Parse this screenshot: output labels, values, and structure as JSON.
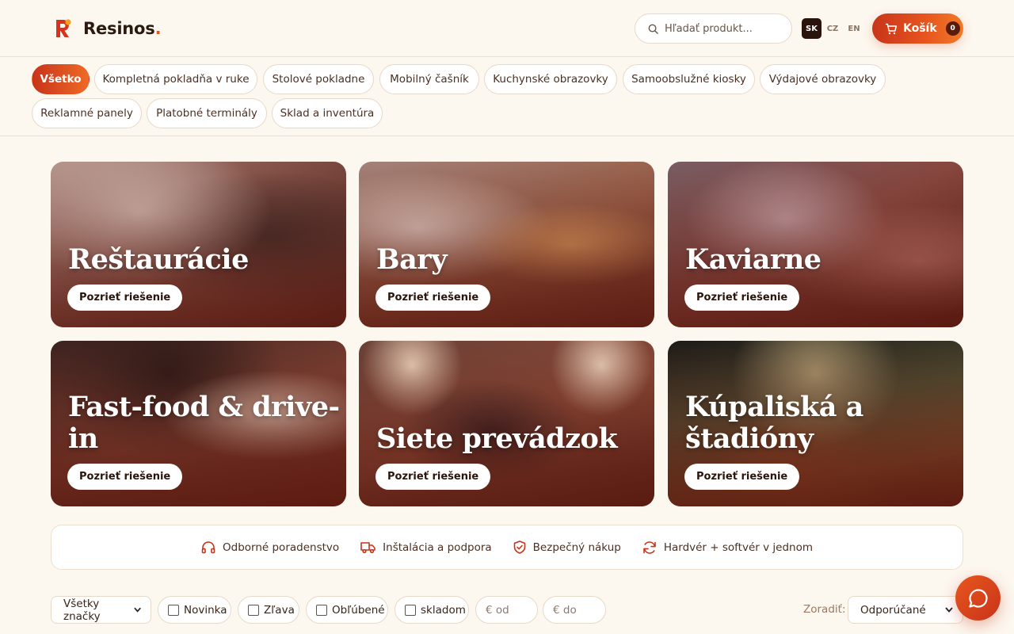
{
  "header": {
    "brand": "Resinos",
    "brand_dot": ".",
    "search_placeholder": "Hľadať produkt...",
    "languages": [
      "SK",
      "CZ",
      "EN"
    ],
    "active_language": "SK",
    "cart_label": "Košík",
    "cart_count": "0"
  },
  "categories": [
    "Všetko",
    "Kompletná pokladňa v ruke",
    "Stolové pokladne",
    "Mobilný čašník",
    "Kuchynské obrazovky",
    "Samoobslužné kiosky",
    "Výdajové obrazovky",
    "Reklamné panely",
    "Platobné terminály",
    "Sklad a inventúra"
  ],
  "active_category": "Všetko",
  "solutions": {
    "button_label": "Pozrieť riešenie",
    "items": [
      {
        "title": "Reštaurácie"
      },
      {
        "title": "Bary"
      },
      {
        "title": "Kaviarne"
      },
      {
        "title": "Fast-food & drive-in"
      },
      {
        "title": "Siete prevádzok"
      },
      {
        "title": "Kúpaliská a štadióny"
      }
    ]
  },
  "benefits": [
    {
      "icon": "headphones-icon",
      "label": "Odborné poradenstvo"
    },
    {
      "icon": "truck-icon",
      "label": "Inštalácia a podpora"
    },
    {
      "icon": "shield-check-icon",
      "label": "Bezpečný nákup"
    },
    {
      "icon": "refresh-icon",
      "label": "Hardvér + softvér v jednom"
    }
  ],
  "filters": {
    "brand_select": "Všetky značky",
    "checkboxes": [
      "Novinka",
      "Zľava",
      "Obľúbené",
      "skladom"
    ],
    "price_from_placeholder": "€ od",
    "price_to_placeholder": "€ do",
    "sort_label": "Zoradiť:",
    "sort_value": "Odporúčané"
  },
  "colors": {
    "accent": "#e8561e",
    "accent_dark": "#c8341a",
    "background": "#fcf7ef",
    "text": "#3a2418"
  }
}
